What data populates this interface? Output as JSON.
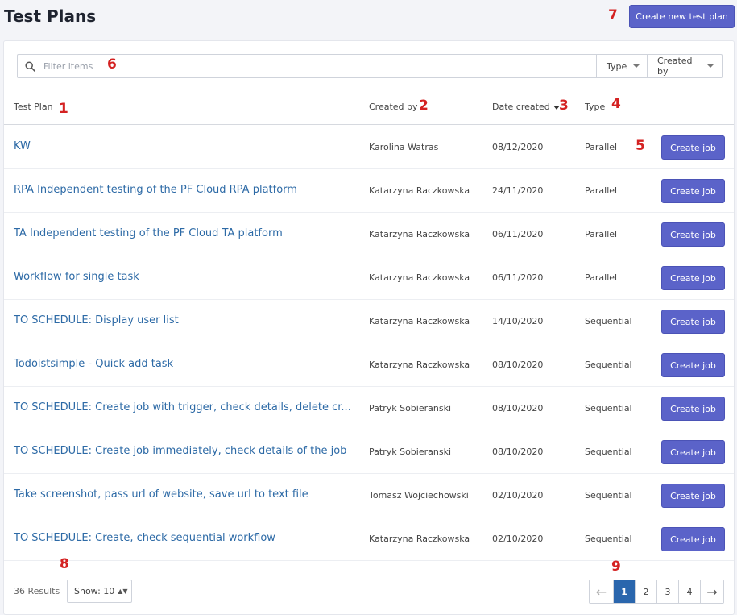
{
  "header": {
    "title": "Test Plans",
    "create_button": "Create new test plan"
  },
  "filter": {
    "placeholder": "Filter items",
    "type_label": "Type",
    "created_by_label": "Created by"
  },
  "table": {
    "columns": {
      "plan": "Test Plan",
      "created_by": "Created by",
      "date": "Date created",
      "type": "Type"
    },
    "rows": [
      {
        "name": "KW",
        "created_by": "Karolina Watras",
        "date": "08/12/2020",
        "type": "Parallel",
        "action": "Create job"
      },
      {
        "name": "RPA Independent testing of the PF Cloud RPA platform",
        "created_by": "Katarzyna Raczkowska",
        "date": "24/11/2020",
        "type": "Parallel",
        "action": "Create job"
      },
      {
        "name": "TA Independent testing of the PF Cloud TA platform",
        "created_by": "Katarzyna Raczkowska",
        "date": "06/11/2020",
        "type": "Parallel",
        "action": "Create job"
      },
      {
        "name": "Workflow for single task",
        "created_by": "Katarzyna Raczkowska",
        "date": "06/11/2020",
        "type": "Parallel",
        "action": "Create job"
      },
      {
        "name": "TO SCHEDULE: Display user list",
        "created_by": "Katarzyna Raczkowska",
        "date": "14/10/2020",
        "type": "Sequential",
        "action": "Create job"
      },
      {
        "name": "Todoistsimple - Quick add task",
        "created_by": "Katarzyna Raczkowska",
        "date": "08/10/2020",
        "type": "Sequential",
        "action": "Create job"
      },
      {
        "name": "TO SCHEDULE: Create job with trigger, check details, delete cr...",
        "created_by": "Patryk Sobieranski",
        "date": "08/10/2020",
        "type": "Sequential",
        "action": "Create job"
      },
      {
        "name": "TO SCHEDULE: Create job immediately, check details of the job",
        "created_by": "Patryk Sobieranski",
        "date": "08/10/2020",
        "type": "Sequential",
        "action": "Create job"
      },
      {
        "name": "Take screenshot, pass url of website, save url to text file",
        "created_by": "Tomasz Wojciechowski",
        "date": "02/10/2020",
        "type": "Sequential",
        "action": "Create job"
      },
      {
        "name": "TO SCHEDULE: Create, check sequential workflow",
        "created_by": "Katarzyna Raczkowska",
        "date": "02/10/2020",
        "type": "Sequential",
        "action": "Create job"
      }
    ]
  },
  "footer": {
    "results": "36 Results",
    "show": "Show: 10",
    "pages": [
      "1",
      "2",
      "3",
      "4"
    ],
    "current_page": "1"
  },
  "annotations": [
    "1",
    "2",
    "3",
    "4",
    "5",
    "6",
    "7",
    "8",
    "9"
  ],
  "colors": {
    "accent": "#5b63c9",
    "link": "#2d6aa6",
    "active_page": "#2a66ad",
    "annotation": "#d42222"
  },
  "icons": {
    "search": "search-icon",
    "prev": "arrow-left-icon",
    "next": "arrow-right-icon"
  }
}
